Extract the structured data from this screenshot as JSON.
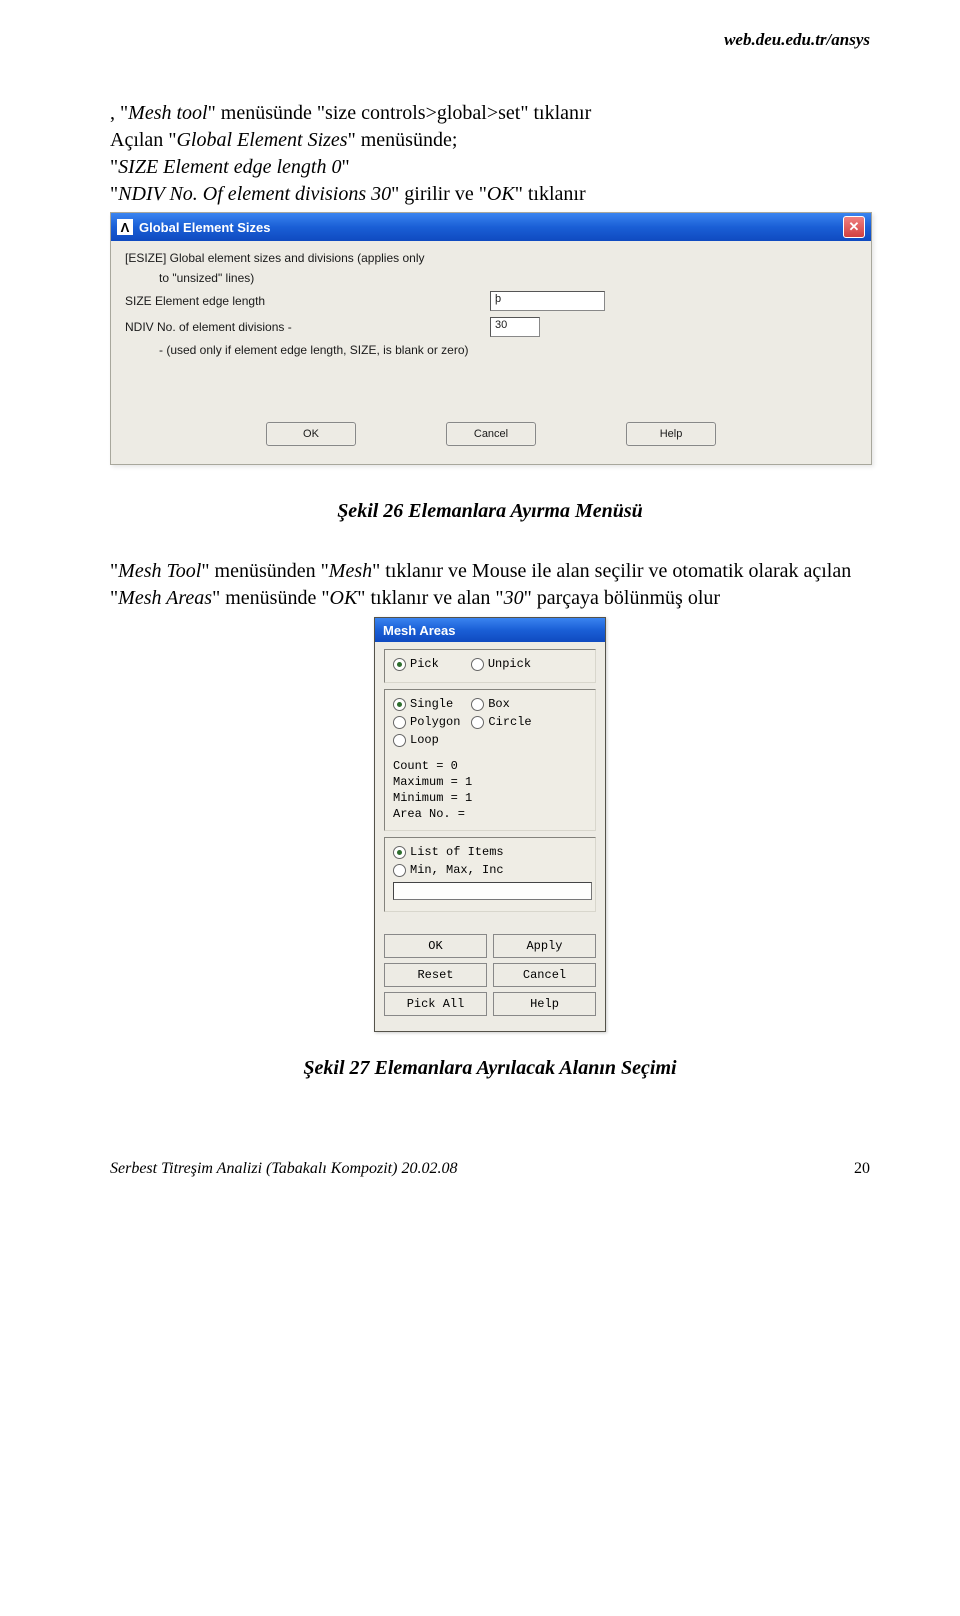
{
  "header": {
    "url": "web.deu.edu.tr/ansys"
  },
  "intro": {
    "line1_prefix": ", ",
    "line1_q1": "Mesh tool",
    "line1_mid": " menüsünde \"size controls>global>set\" tıklanır",
    "line2_prefix": "Açılan ",
    "line2_q": "Global Element Sizes",
    "line2_suffix": " menüsünde;",
    "line3_q": "SIZE Element edge length 0",
    "line4_q": "NDIV No. Of element divisions 30",
    "line4_mid": "  girilir ve ",
    "line4_q2": "OK",
    "line4_suffix": " tıklanır"
  },
  "dlg1": {
    "title": "Global Element Sizes",
    "icon_char": "Λ",
    "close_char": "✕",
    "row1": "[ESIZE]  Global element sizes and divisions (applies only",
    "row2": "to \"unsized\" lines)",
    "row3": "SIZE  Element edge length",
    "row4": "NDIV  No. of element divisions -",
    "row5": "- (used only if element edge length, SIZE, is blank or zero)",
    "input1": "þ",
    "input2": "30",
    "btn_ok": "OK",
    "btn_cancel": "Cancel",
    "btn_help": "Help"
  },
  "caption26": "Şekil 26 Elemanlara Ayırma Menüsü",
  "mid": {
    "p_q1": "Mesh Tool",
    "p_mid1": " menüsünden ",
    "p_q2": "Mesh",
    "p_mid2": " tıklanır ve Mouse ile alan seçilir ve otomatik olarak açılan ",
    "p2_q1": "Mesh Areas",
    "p2_mid1": " menüsünde ",
    "p2_q2": "OK",
    "p2_mid2": " tıklanır ve alan ",
    "p2_q3": "30",
    "p2_suffix": "  parçaya bölünmüş olur"
  },
  "dlg2": {
    "title": "Mesh Areas",
    "pick": "Pick",
    "unpick": "Unpick",
    "single": "Single",
    "box": "Box",
    "polygon": "Polygon",
    "circle": "Circle",
    "loop": "Loop",
    "count": "Count    =  0",
    "max": "Maximum  =  1",
    "min": "Minimum  =  1",
    "area": "Area No. =",
    "list": "List of Items",
    "mmi": "Min, Max, Inc",
    "btn_ok": "OK",
    "btn_apply": "Apply",
    "btn_reset": "Reset",
    "btn_cancel": "Cancel",
    "btn_pickall": "Pick All",
    "btn_help": "Help"
  },
  "caption27": "Şekil 27 Elemanlara Ayrılacak Alanın Seçimi",
  "footer": {
    "left": "Serbest Titreşim Analizi (Tabakalı Kompozit)  20.02.08",
    "right": "20"
  }
}
